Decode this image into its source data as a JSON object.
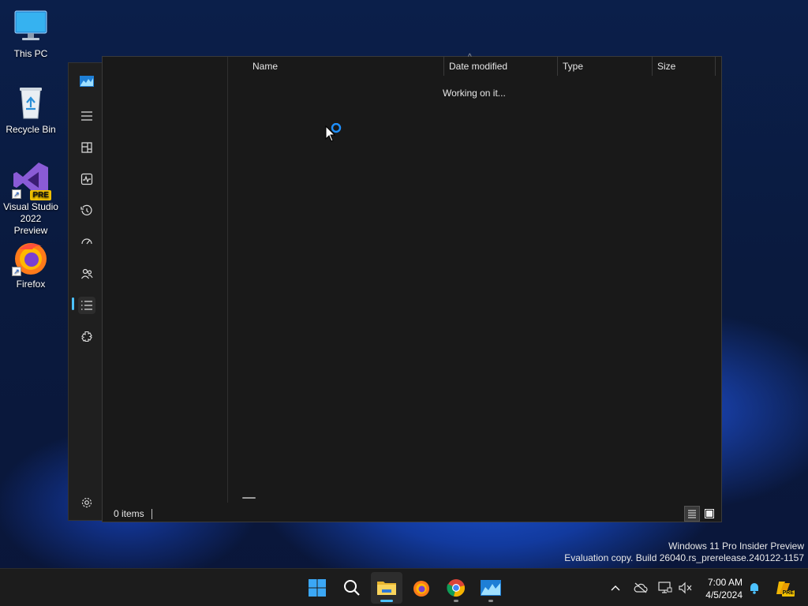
{
  "desktop": {
    "icons": [
      {
        "label": "This PC"
      },
      {
        "label": "Recycle Bin"
      },
      {
        "label": "Visual Studio 2022 Preview",
        "badge": "PRE"
      },
      {
        "label": "Firefox"
      }
    ]
  },
  "explorer": {
    "columns": [
      "Name",
      "Date modified",
      "Type",
      "Size"
    ],
    "loading_text": "Working on it...",
    "status_text": "0 items"
  },
  "watermark": {
    "line1": "Windows 11 Pro Insider Preview",
    "line2": "Evaluation copy. Build 26040.rs_prerelease.240122-1157"
  },
  "taskbar": {
    "time": "7:00 AM",
    "date": "4/5/2024",
    "tray_badge": "PRE"
  },
  "colors": {
    "accent": "#4cc2ff",
    "window_bg": "#191919",
    "taskbar_bg": "#1c1c1c"
  }
}
